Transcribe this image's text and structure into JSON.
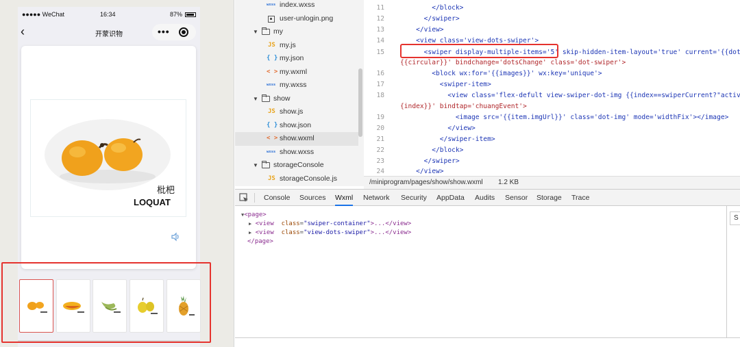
{
  "simulator": {
    "status": {
      "carrier": "●●●●● WeChat",
      "time": "16:34",
      "battery": "87%"
    },
    "nav_title": "开蒙识物",
    "main_image": {
      "fruit": "loquat",
      "caption_cn": "枇杷",
      "caption_en": "LOQUAT"
    },
    "thumbnails": [
      {
        "fruit": "loquat",
        "active": true
      },
      {
        "fruit": "mango",
        "active": false
      },
      {
        "fruit": "beans",
        "active": false
      },
      {
        "fruit": "pear",
        "active": false
      },
      {
        "fruit": "pineapple",
        "active": false
      }
    ],
    "highlight_color": "#e5322d"
  },
  "file_tree": {
    "rows": [
      {
        "type": "wxss",
        "label": "index.wxss"
      },
      {
        "type": "png",
        "label": "user-unlogin.png"
      },
      {
        "type": "folder",
        "label": "my"
      },
      {
        "type": "js",
        "label": "my.js"
      },
      {
        "type": "json",
        "label": "my.json"
      },
      {
        "type": "wxml",
        "label": "my.wxml"
      },
      {
        "type": "wxss",
        "label": "my.wxss"
      },
      {
        "type": "folder",
        "label": "show"
      },
      {
        "type": "js",
        "label": "show.js"
      },
      {
        "type": "json",
        "label": "show.json"
      },
      {
        "type": "wxml",
        "label": "show.wxml",
        "selected": true
      },
      {
        "type": "wxss",
        "label": "show.wxss"
      },
      {
        "type": "folder",
        "label": "storageConsole"
      },
      {
        "type": "js",
        "label": "storageConsole.js"
      }
    ],
    "type_glyphs": {
      "js": "JS",
      "json": "{ }",
      "wxml": "< >",
      "wxss": "wxss"
    }
  },
  "editor": {
    "line_numbers": [
      "11",
      "12",
      "13",
      "14",
      "15",
      "16",
      "17",
      "18",
      "19",
      "20",
      "21",
      "22",
      "23",
      "24"
    ],
    "lines": [
      [
        "        ",
        "</block>"
      ],
      [
        "      ",
        "</swiper>"
      ],
      [
        "    ",
        "</view>"
      ],
      [
        "    ",
        "<view class='view-dots-swiper'>"
      ],
      [
        "      ",
        "<swiper display-multiple-items='5' skip-hidden-item-layout='true' current='{{dots"
      ],
      [
        "",
        "{{circular}}' bindchange='dotsChange' class='dot-swiper'>"
      ],
      [
        "        ",
        "<block wx:for='{{images}}' wx:key='unique'>"
      ],
      [
        "          ",
        "<swiper-item>"
      ],
      [
        "            ",
        "<view class='flex-defult view-swiper-dot-img {{index==swiperCurrent?\"active"
      ],
      [
        "",
        "{index}}' bindtap='chuangEvent'>"
      ],
      [
        "              ",
        "<image src='{{item.imgUrl}}' class='dot-img' mode='widthFix'></image>"
      ],
      [
        "            ",
        "</view>"
      ],
      [
        "          ",
        "</swiper-item>"
      ],
      [
        "        ",
        "</block>"
      ],
      [
        "      ",
        "</swiper>"
      ],
      [
        "    ",
        "</view>"
      ]
    ],
    "path": "/miniprogram/pages/show/show.wxml",
    "size": "1.2 KB"
  },
  "devtools": {
    "tabs": [
      "Console",
      "Sources",
      "Wxml",
      "Network",
      "Security",
      "AppData",
      "Audits",
      "Sensor",
      "Storage",
      "Trace"
    ],
    "active_tab": "Wxml",
    "dom": {
      "page_open": "<page>",
      "child1_tag": "<view",
      "child1_attr": "class",
      "child1_val": "\"swiper-container\"",
      "child2_tag": "<view",
      "child2_attr": "class",
      "child2_val": "\"view-dots-swiper\"",
      "child_tail": ">...</view>",
      "page_close": "</page>"
    },
    "right_panel_label": "S"
  }
}
